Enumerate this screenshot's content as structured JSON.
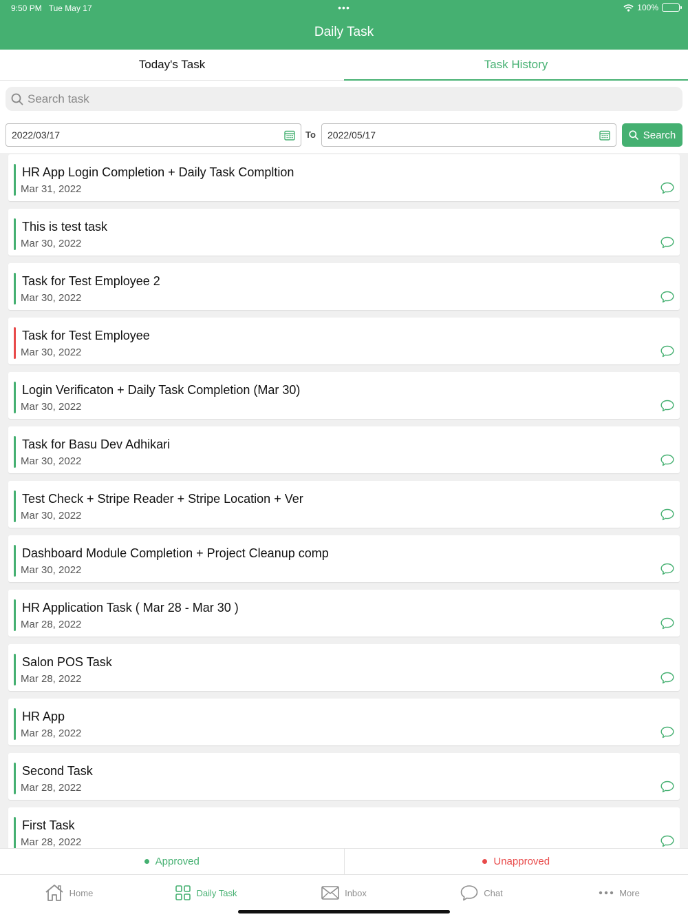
{
  "status_bar": {
    "time": "9:50 PM",
    "date": "Tue May 17",
    "dots": "•••",
    "battery": "100%"
  },
  "header": {
    "title": "Daily Task"
  },
  "tabs": [
    {
      "label": "Today's Task",
      "active": false
    },
    {
      "label": "Task History",
      "active": true
    }
  ],
  "search": {
    "placeholder": "Search task",
    "value": ""
  },
  "filter": {
    "from_date": "2022/03/17",
    "to_label": "To",
    "to_date": "2022/05/17",
    "button_label": "Search"
  },
  "colors": {
    "accent": "#45b071",
    "approved": "#45b071",
    "unapproved": "#e84a4a"
  },
  "tasks": [
    {
      "title": "HR App Login Completion + Daily Task Compltion",
      "date": "Mar 31, 2022",
      "status": "approved"
    },
    {
      "title": "This is test task",
      "date": "Mar 30, 2022",
      "status": "approved"
    },
    {
      "title": "Task for Test Employee 2",
      "date": "Mar 30, 2022",
      "status": "approved"
    },
    {
      "title": "Task for Test Employee",
      "date": "Mar 30, 2022",
      "status": "unapproved"
    },
    {
      "title": "Login Verificaton + Daily Task Completion (Mar 30)",
      "date": "Mar 30, 2022",
      "status": "approved"
    },
    {
      "title": "Task for Basu Dev Adhikari",
      "date": "Mar 30, 2022",
      "status": "approved"
    },
    {
      "title": "Test Check + Stripe Reader + Stripe Location + Ver",
      "date": "Mar 30, 2022",
      "status": "approved"
    },
    {
      "title": "Dashboard Module Completion + Project Cleanup comp",
      "date": "Mar 30, 2022",
      "status": "approved"
    },
    {
      "title": "HR Application Task ( Mar 28 - Mar 30 )",
      "date": "Mar 28, 2022",
      "status": "approved"
    },
    {
      "title": "Salon POS Task",
      "date": "Mar 28, 2022",
      "status": "approved"
    },
    {
      "title": "HR App",
      "date": "Mar 28, 2022",
      "status": "approved"
    },
    {
      "title": "Second Task",
      "date": "Mar 28, 2022",
      "status": "approved"
    },
    {
      "title": "First Task",
      "date": "Mar 28, 2022",
      "status": "approved"
    }
  ],
  "legend": {
    "approved": "Approved",
    "unapproved": "Unapproved"
  },
  "nav": [
    {
      "label": "Home",
      "icon": "home-icon",
      "active": false
    },
    {
      "label": "Daily Task",
      "icon": "grid-icon",
      "active": true
    },
    {
      "label": "Inbox",
      "icon": "mail-icon",
      "active": false
    },
    {
      "label": "Chat",
      "icon": "chat-bubble-icon",
      "active": false
    },
    {
      "label": "More",
      "icon": "more-icon",
      "active": false
    }
  ]
}
